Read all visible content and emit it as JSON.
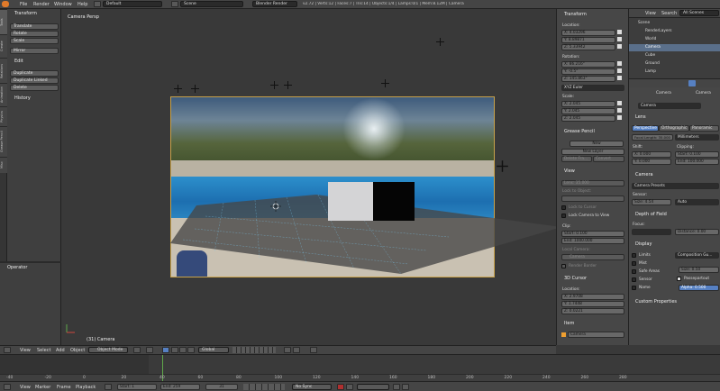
{
  "app": {
    "menus": [
      "File",
      "Render",
      "Window",
      "Help"
    ],
    "layout": "Default",
    "scene": "Scene",
    "engine": "Blender Render",
    "status": "v2.72 | Verts:12 | Faces:7 | Tris:14 | Objects:1/4 | Lamps:0/1 | Mem:8.12M | Camera"
  },
  "toolshelf": {
    "transform_title": "Transform",
    "transform_buttons": [
      "Translate",
      "Rotate",
      "Scale"
    ],
    "mirror": "Mirror",
    "edit_title": "Edit",
    "edit_buttons": [
      "Duplicate",
      "Duplicate Linked",
      "Delete"
    ],
    "history_title": "History",
    "operator_title": "Operator",
    "tabs": [
      "Tools",
      "Create",
      "Relations",
      "Animation",
      "Physics",
      "Grease Pencil",
      "Misc"
    ]
  },
  "viewport": {
    "persp_label": "Camera Persp",
    "object_label": "(31) Camera"
  },
  "npanel": {
    "transform": "Transform",
    "location": "Location:",
    "loc": [
      "X:     4.03296",
      "Y:     8.89871",
      "Z:     5.33942"
    ],
    "rotation": "Rotation:",
    "rot": [
      "X:   86.216°",
      "Y:       -0.5°",
      "Z:  145.863°"
    ],
    "euler": "XYZ Euler",
    "scale": "Scale:",
    "scl": [
      "X:     2.045",
      "Y:     2.045",
      "Z:     2.045"
    ],
    "grease": "Grease Pencil",
    "new": "New",
    "new_layer": "New Layer",
    "delete_frame": "Delete Fra...",
    "convert": "Convert",
    "view": "View",
    "lens": "Lens:    35.000",
    "lock_object": "Lock to Object:",
    "lock_cursor": "Lock to Cursor",
    "lock_camera": "Lock Camera to View",
    "clip": "Clip:",
    "start": "Start:     0.100",
    "end": "End:   1000.000",
    "local_camera": "Local Camera:",
    "camera_sel": "Camera",
    "render_border": "Render Border",
    "cursor": "3D Cursor",
    "cursor_location": "Location:",
    "cur": [
      "X:     2.9708",
      "Y:     1.7448",
      "Z:     0.0221"
    ],
    "item": "Item",
    "item_name": "Camera"
  },
  "outliner": {
    "view": "View",
    "search": "Search",
    "all_scenes": "All Scenes",
    "items": [
      "Scene",
      "RenderLayers",
      "World",
      "Camera",
      "Cube",
      "Ground",
      "Lamp"
    ]
  },
  "properties": {
    "camera_tab": "Camera",
    "camera_name": "Camera",
    "lens": "Lens",
    "types": [
      "Perspective",
      "Orthographic",
      "Panoramic"
    ],
    "focal": "Focal Length: 35.000",
    "units": "Millimeters",
    "shift": "Shift:",
    "shift_x": "X:       0.000",
    "shift_y": "Y:       0.000",
    "clipping": "Clipping:",
    "clip_start": "Start:    0.100",
    "clip_end": "End:  100.000",
    "camera_section": "Camera",
    "presets": "Camera Presets",
    "sensor": "Sensor:",
    "size": "Size:     4.54",
    "auto": "Auto",
    "dof": "Depth of Field",
    "focus": "Focus:",
    "distance": "Distance:  0.00",
    "display": "Display",
    "display_items": [
      "Limits",
      "Mist",
      "Safe Areas",
      "Sensor",
      "Name"
    ],
    "comp_guides": "Composition Gu...",
    "disp_size": "Size:    0.50",
    "passepartout": "Passepartout",
    "alpha": "Alpha:    0.500",
    "custom": "Custom Properties"
  },
  "vpheader": {
    "menus": [
      "View",
      "Select",
      "Add",
      "Object"
    ],
    "mode": "Object Mode",
    "orientation": "Global"
  },
  "timeline": {
    "ticks": [
      "-40",
      "-20",
      "0",
      "20",
      "40",
      "60",
      "80",
      "100",
      "120",
      "140",
      "160",
      "180",
      "200",
      "220",
      "240",
      "260",
      "280"
    ],
    "menus": [
      "View",
      "Marker",
      "Frame",
      "Playback"
    ],
    "start": "Start:      1",
    "end": "End:     259",
    "frame": "31",
    "sync": "No Sync"
  },
  "colors": {
    "accent": "#5680c2",
    "cam_frame": "#c8a24a",
    "selected_orange": "#f0a030"
  }
}
